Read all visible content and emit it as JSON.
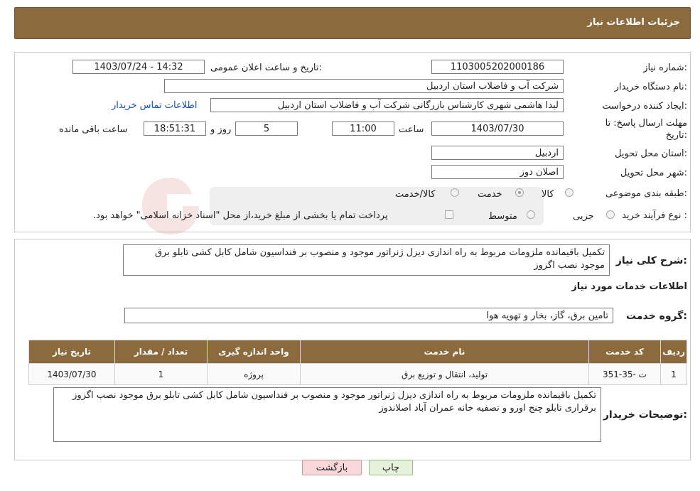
{
  "header": {
    "title": "جزئیات اطلاعات نیاز"
  },
  "form": {
    "need_number_label": "شماره نیاز:",
    "need_number": "1103005202000186",
    "announce_label": "تاریخ و ساعت اعلان عمومی:",
    "announce_value": "1403/07/24 - 14:32",
    "buyer_org_label": "نام دستگاه خریدار:",
    "buyer_org": "شرکت آب و فاضلاب استان اردبیل",
    "requester_label": "ایجاد کننده درخواست:",
    "requester": "لیدا  هاشمی شهری کارشناس بازرگانی شرکت آب و فاضلاب استان اردبیل",
    "contact_link": "اطلاعات تماس خریدار",
    "deadline_label_1": "مهلت ارسال پاسخ: تا",
    "deadline_label_2": "تاریخ:",
    "deadline_date": "1403/07/30",
    "time_label": "ساعت",
    "deadline_time": "11:00",
    "days_value": "5",
    "days_label": "روز و",
    "remaining_time": "18:51:31",
    "remaining_label": "ساعت باقی مانده",
    "province_label": "استان محل تحویل:",
    "province": "اردبیل",
    "city_label": "شهر محل تحویل:",
    "city": "اصلان دوز",
    "category_label": "طبقه بندی موضوعی:",
    "category_options": [
      "کالا",
      "خدمت",
      "کالا/خدمت"
    ],
    "category_selected": "خدمت",
    "purchase_type_label": "نوع فرآیند خرید :",
    "purchase_type_options": [
      "جزیی",
      "متوسط"
    ],
    "purchase_note": "پرداخت تمام یا بخشی از مبلغ خرید،از محل \"اسناد خزانه اسلامی\" خواهد بود."
  },
  "description": {
    "label": "شرح کلی نیاز:",
    "text": "تکمیل باقیمانده ملزومات مربوط به راه اندازی دیزل ژنراتور موجود و منصوب بر فنداسیون شامل کابل کشی تابلو برق موجود نصب اگزوز"
  },
  "services": {
    "section_title": "اطلاعات خدمات مورد نیاز",
    "group_label": "گروه خدمت:",
    "group_value": "تامین برق، گاز، بخار و تهویه هوا"
  },
  "table": {
    "headers": [
      "ردیف",
      "کد خدمت",
      "نام خدمت",
      "واحد اندازه گیری",
      "تعداد / مقدار",
      "تاریخ نیاز"
    ],
    "rows": [
      [
        "1",
        "ت -35-351",
        "تولید، انتقال و توزیع برق",
        "پروژه",
        "1",
        "1403/07/30"
      ]
    ]
  },
  "buyer_notes": {
    "label": "توضیحات خریدار:",
    "text": "تکمیل باقیمانده ملزومات مربوط به راه اندازی دیزل ژنراتور موجود و منصوب بر فنداسیون شامل کابل کشی تابلو برق موجود نصب اگزوز برقراری تابلو چنج اورو و تصفیه خانه عمران آباد اصلاندوز"
  },
  "buttons": {
    "print": "چاپ",
    "back": "بازگشت"
  },
  "colors": {
    "header_bg": "#8b6a3e",
    "link": "#1a4fb8"
  }
}
